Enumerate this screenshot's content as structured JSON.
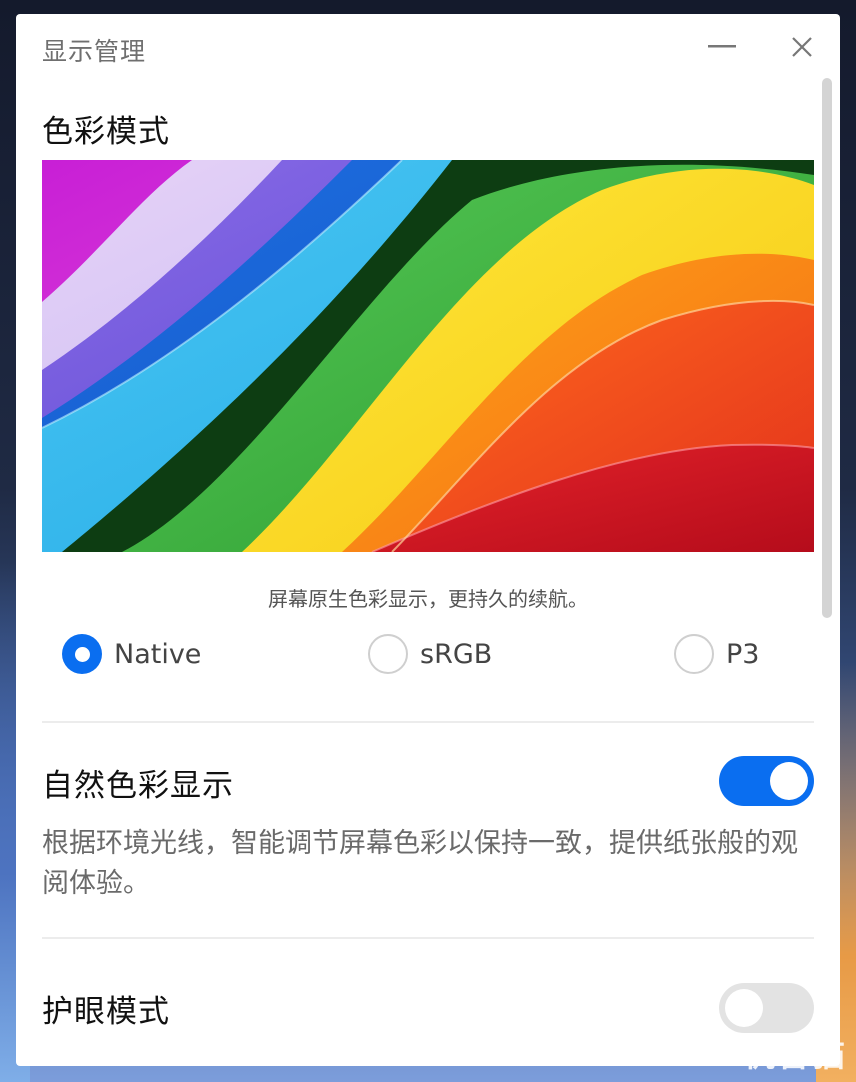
{
  "window": {
    "title": "显示管理",
    "minimize_icon": "minimize-icon",
    "close_icon": "close-icon"
  },
  "color_mode": {
    "title": "色彩模式",
    "description": "屏幕原生色彩显示，更持久的续航。",
    "options": [
      {
        "label": "Native",
        "selected": true
      },
      {
        "label": "sRGB",
        "selected": false
      },
      {
        "label": "P3",
        "selected": false
      }
    ]
  },
  "natural_color": {
    "title": "自然色彩显示",
    "description": "根据环境光线，智能调节屏幕色彩以保持一致，提供纸张般的观阅体验。",
    "enabled": true
  },
  "eye_care": {
    "title": "护眼模式",
    "enabled": false
  },
  "watermark": "机智猫",
  "colors": {
    "accent": "#0a6ef0",
    "toggle_off": "#e3e3e3",
    "window_bg": "#ffffff"
  }
}
